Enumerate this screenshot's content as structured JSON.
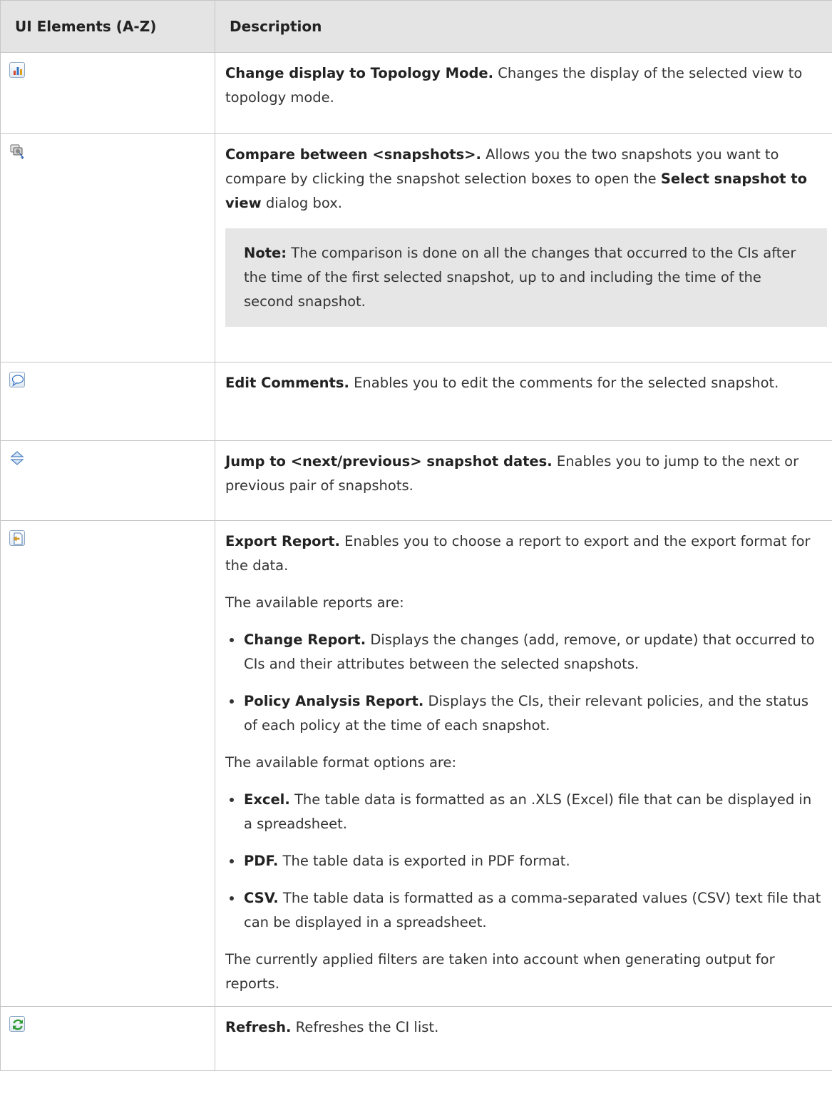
{
  "header": {
    "col1": "UI Elements (A-Z)",
    "col2": "Description"
  },
  "rows": [
    {
      "icon": "topology-mode-icon",
      "title": "Change display to Topology Mode.",
      "text": " Changes the display of the selected view to topology mode."
    },
    {
      "icon": "compare-snapshots-icon",
      "title": "Compare between <snapshots>.",
      "text_a": " Allows you the two snapshots you want to compare by clicking the snapshot selection boxes to open the ",
      "bold_b": "Select snapshot to view",
      "text_c": " dialog box.",
      "note_label": "Note:",
      "note_text": " The comparison is done on all the changes that occurred to the CIs after the time of the first selected snapshot, up to and including the time of the second snapshot."
    },
    {
      "icon": "edit-comments-icon",
      "title": "Edit Comments.",
      "text": " Enables you to edit the comments for the selected snapshot."
    },
    {
      "icon": "jump-snapshot-dates-icon",
      "title": "Jump to <next/previous> snapshot dates.",
      "text": " Enables you to jump to the next or previous pair of snapshots."
    },
    {
      "icon": "export-report-icon",
      "title": "Export Report.",
      "text": " Enables you to choose a report to export and the export format for the data.",
      "reports_intro": "The available reports are:",
      "reports": [
        {
          "label": "Change Report.",
          "text": " Displays the changes (add, remove, or update) that occurred to CIs and their attributes between the selected snapshots."
        },
        {
          "label": "Policy Analysis Report.",
          "text": " Displays the CIs, their relevant policies, and the status of each policy at the time of each snapshot."
        }
      ],
      "formats_intro": "The available format options are:",
      "formats": [
        {
          "label": "Excel.",
          "text": " The table data is formatted as an .XLS (Excel) file that can be displayed in a spreadsheet."
        },
        {
          "label": "PDF.",
          "text": " The table data is exported in PDF format."
        },
        {
          "label": "CSV.",
          "text": " The table data is formatted as a comma-separated values (CSV) text file that can be displayed in a spreadsheet."
        }
      ],
      "footer": "The currently applied filters are taken into account when generating output for reports."
    },
    {
      "icon": "refresh-icon",
      "title": "Refresh.",
      "text": " Refreshes the CI list."
    }
  ]
}
